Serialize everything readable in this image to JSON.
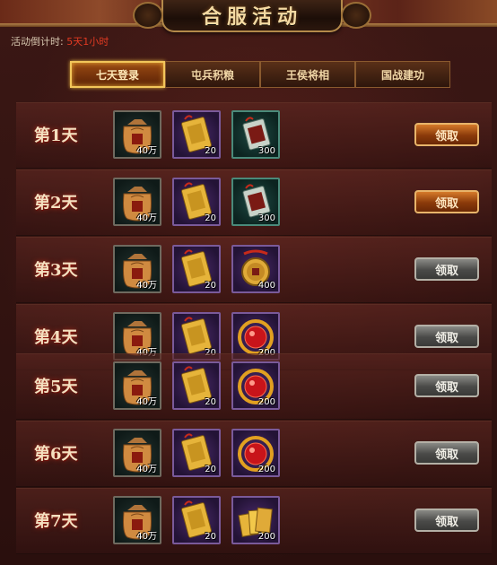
{
  "header": {
    "title": "合服活动",
    "countdown_label": "活动倒计时:",
    "countdown_value": "5天1小时"
  },
  "tabs": [
    {
      "label": "七天登录",
      "active": true
    },
    {
      "label": "屯兵积粮",
      "active": false
    },
    {
      "label": "王侯将相",
      "active": false
    },
    {
      "label": "国战建功",
      "active": false
    }
  ],
  "rows": [
    {
      "day": "第1天",
      "button": "领取",
      "button_state": "active",
      "items": [
        {
          "type": "grain-bag",
          "qty": "40万"
        },
        {
          "type": "purple-token",
          "qty": "20"
        },
        {
          "type": "green-token",
          "qty": "300"
        }
      ]
    },
    {
      "day": "第2天",
      "button": "领取",
      "button_state": "active",
      "items": [
        {
          "type": "grain-bag",
          "qty": "40万"
        },
        {
          "type": "purple-token",
          "qty": "20"
        },
        {
          "type": "green-token",
          "qty": "300"
        }
      ]
    },
    {
      "day": "第3天",
      "button": "领取",
      "button_state": "disabled",
      "items": [
        {
          "type": "grain-bag",
          "qty": "40万"
        },
        {
          "type": "purple-token",
          "qty": "20"
        },
        {
          "type": "gold-medallion",
          "qty": "400"
        }
      ]
    },
    {
      "day": "第4天",
      "button": "领取",
      "button_state": "disabled",
      "items": [
        {
          "type": "grain-bag",
          "qty": "40万"
        },
        {
          "type": "purple-token",
          "qty": "20"
        },
        {
          "type": "dragon-orb",
          "qty": "200"
        }
      ]
    },
    {
      "day": "第5天",
      "button": "领取",
      "button_state": "disabled",
      "items": [
        {
          "type": "grain-bag",
          "qty": "40万"
        },
        {
          "type": "purple-token",
          "qty": "20"
        },
        {
          "type": "dragon-orb",
          "qty": "200"
        }
      ]
    },
    {
      "day": "第6天",
      "button": "领取",
      "button_state": "disabled",
      "items": [
        {
          "type": "grain-bag",
          "qty": "40万"
        },
        {
          "type": "purple-token",
          "qty": "20"
        },
        {
          "type": "dragon-orb",
          "qty": "200"
        }
      ]
    },
    {
      "day": "第7天",
      "button": "领取",
      "button_state": "disabled",
      "items": [
        {
          "type": "grain-bag",
          "qty": "40万"
        },
        {
          "type": "purple-token",
          "qty": "20"
        },
        {
          "type": "gold-ingots",
          "qty": "200"
        }
      ]
    }
  ]
}
